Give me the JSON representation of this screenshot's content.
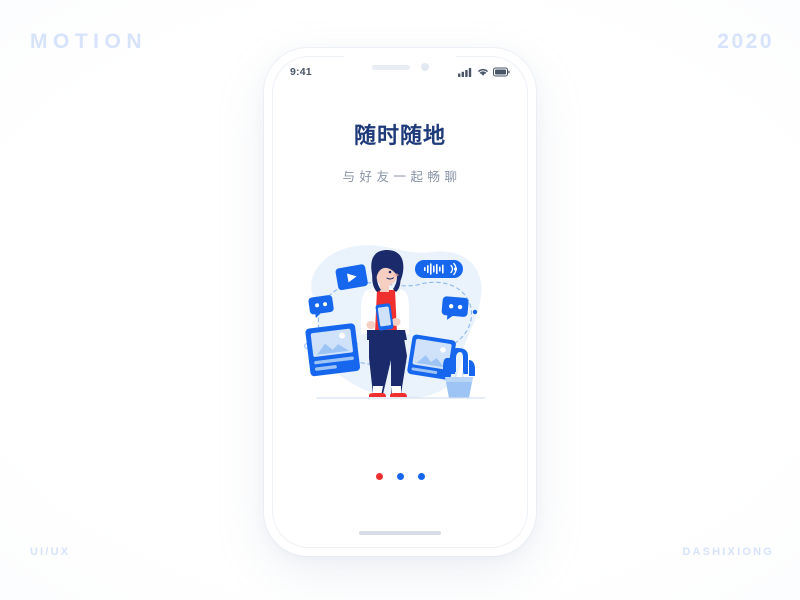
{
  "canvas": {
    "background_color": "#ffffff",
    "corner_label_color": "#d7e3fb"
  },
  "corners": {
    "top_left": "MOTION",
    "top_right": "2020",
    "bottom_left": "UI/UX",
    "bottom_right": "DASHIXIONG"
  },
  "phone": {
    "status_bar": {
      "time": "9:41",
      "icons": [
        "signal-icon",
        "wifi-icon",
        "battery-icon"
      ]
    },
    "notch": {
      "speaker": "speaker-slot",
      "camera": "front-camera"
    },
    "screen": {
      "title": "随时随地",
      "subtitle": "与好友一起畅聊",
      "title_color": "#1f3a7a",
      "subtitle_color": "#8a94a6"
    },
    "pager": {
      "dots": [
        {
          "name": "page-dot-1",
          "color": "#f02f2f",
          "active": true
        },
        {
          "name": "page-dot-2",
          "color": "#1667ee",
          "active": false
        },
        {
          "name": "page-dot-3",
          "color": "#1667ee",
          "active": false
        }
      ]
    },
    "home_indicator": "home-indicator"
  },
  "illustration": {
    "name": "chat-anywhere-illustration",
    "palette": {
      "blob": "#eaf2fb",
      "primary_blue": "#1667ee",
      "deep_navy": "#1b2a6b",
      "light_blue": "#9dc4f5",
      "pale_blue": "#cfe2fa",
      "red": "#f02f2f",
      "white": "#ffffff"
    },
    "elements": [
      "background-blob",
      "video-play-card",
      "chat-bubble-left",
      "photo-card-left",
      "photo-card-right",
      "chat-bubble-right",
      "voice-message-bubble",
      "dashed-connection-path",
      "woman-with-phone",
      "cactus-plant",
      "ground-line"
    ]
  }
}
